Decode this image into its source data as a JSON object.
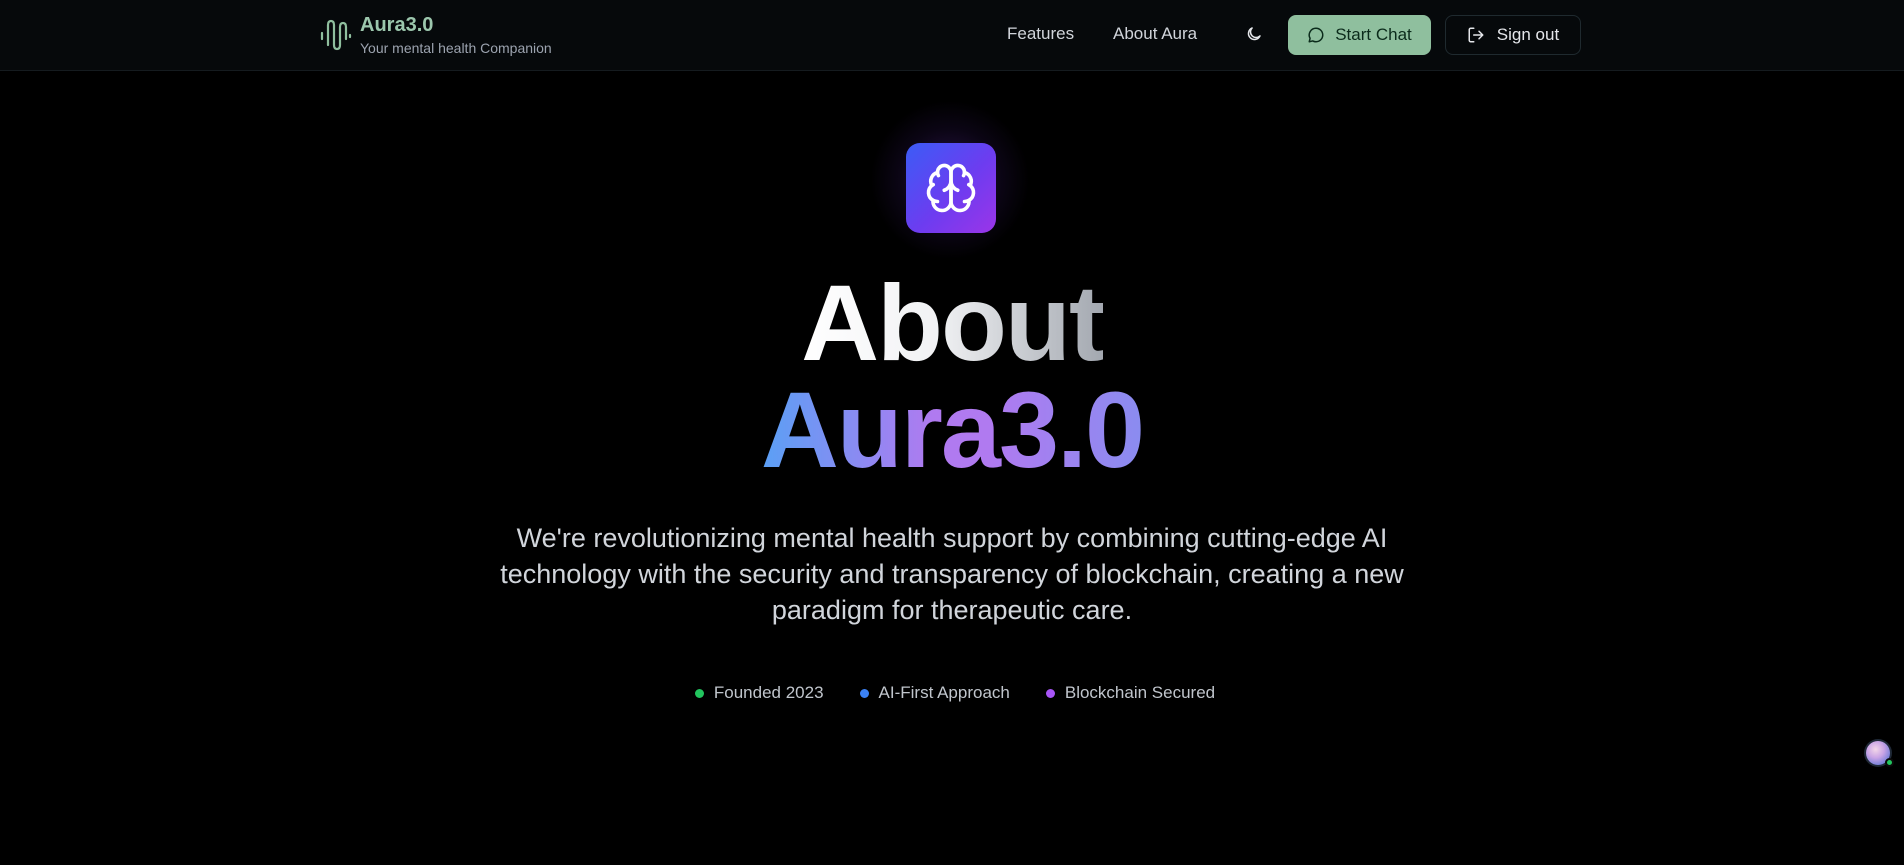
{
  "header": {
    "brand_name": "Aura3.0",
    "tagline": "Your mental health Companion",
    "nav": [
      {
        "label": "Features"
      },
      {
        "label": "About Aura"
      }
    ],
    "start_chat_label": "Start Chat",
    "sign_out_label": "Sign out",
    "icons": {
      "logo": "audio-wave-icon",
      "theme": "moon-icon",
      "chat": "message-circle-icon",
      "sign_out": "log-out-icon"
    }
  },
  "hero": {
    "icon": "brain-icon",
    "title_line1": "About",
    "title_line2": "Aura3.0",
    "description": "We're revolutionizing mental health support by combining cutting-edge AI technology with the security and transparency of blockchain, creating a new paradigm for therapeutic care.",
    "badges": [
      {
        "label": "Founded 2023",
        "color": "#22c55e"
      },
      {
        "label": "AI-First Approach",
        "color": "#3b82f6"
      },
      {
        "label": "Blockchain Secured",
        "color": "#a855f7"
      }
    ]
  },
  "colors": {
    "background": "#000000",
    "header_bg": "#06090b",
    "accent_green": "#8fbf9e",
    "brand_text": "#9cc7ad",
    "hero_icon_gradient": [
      "#3b5cf6",
      "#9b35e8"
    ]
  }
}
